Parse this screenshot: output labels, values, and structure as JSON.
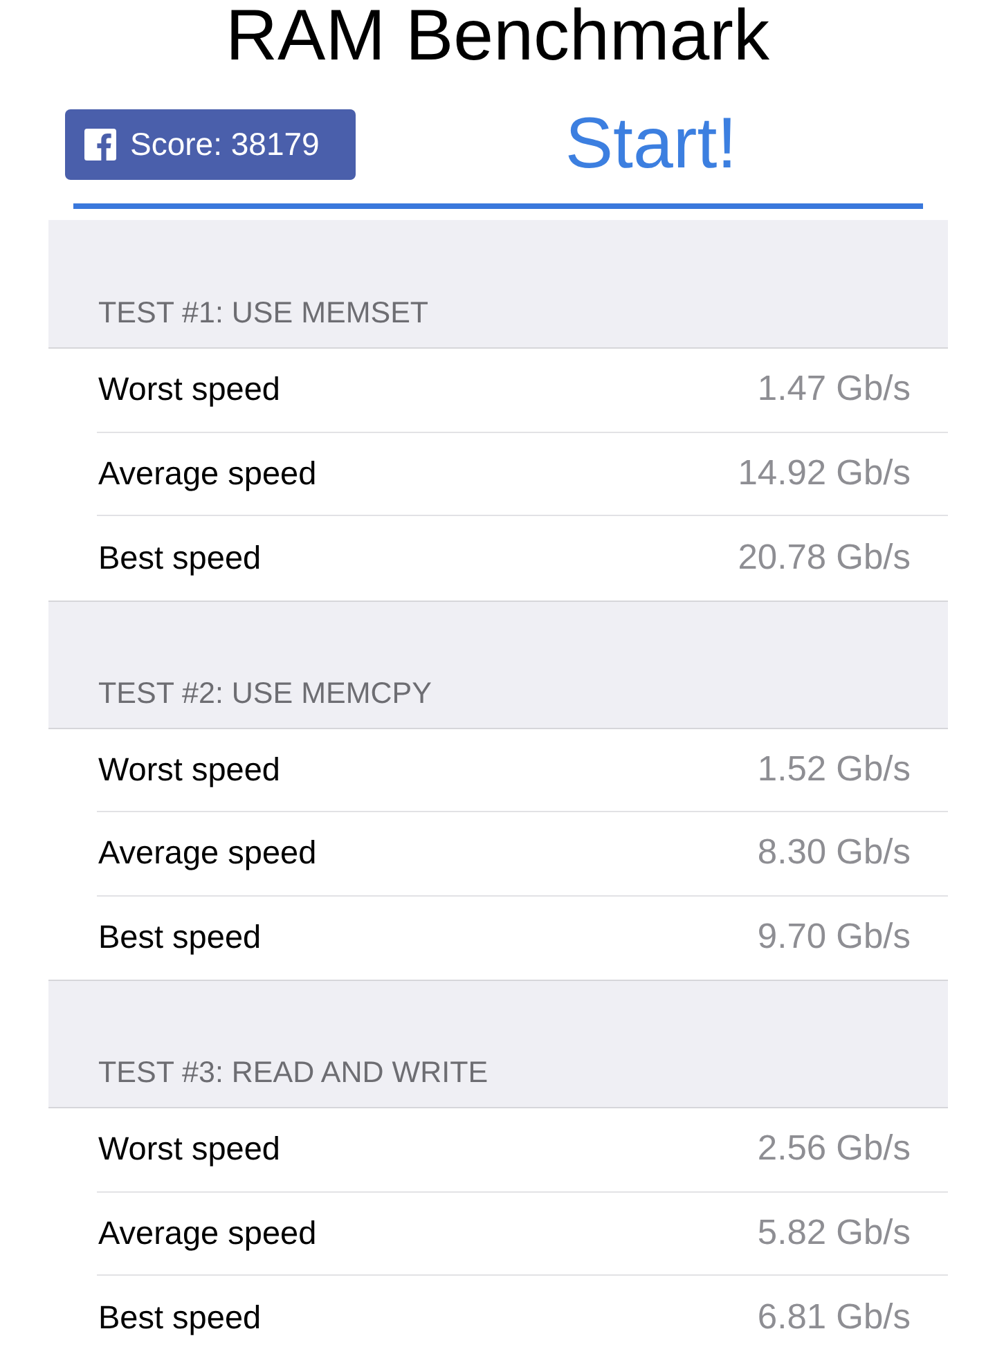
{
  "title": "RAM Benchmark",
  "share_button": {
    "label": "Score: 38179"
  },
  "start_button": {
    "label": "Start!"
  },
  "tests": [
    {
      "heading": "TEST #1: USE MEMSET",
      "rows": [
        {
          "label": "Worst speed",
          "value": "1.47 Gb/s"
        },
        {
          "label": "Average speed",
          "value": "14.92 Gb/s"
        },
        {
          "label": "Best speed",
          "value": "20.78 Gb/s"
        }
      ]
    },
    {
      "heading": "TEST #2: USE MEMCPY",
      "rows": [
        {
          "label": "Worst speed",
          "value": "1.52 Gb/s"
        },
        {
          "label": "Average speed",
          "value": "8.30 Gb/s"
        },
        {
          "label": "Best speed",
          "value": "9.70 Gb/s"
        }
      ]
    },
    {
      "heading": "TEST #3: READ AND WRITE",
      "rows": [
        {
          "label": "Worst speed",
          "value": "2.56 Gb/s"
        },
        {
          "label": "Average speed",
          "value": "5.82 Gb/s"
        },
        {
          "label": "Best speed",
          "value": "6.81 Gb/s"
        }
      ]
    }
  ]
}
